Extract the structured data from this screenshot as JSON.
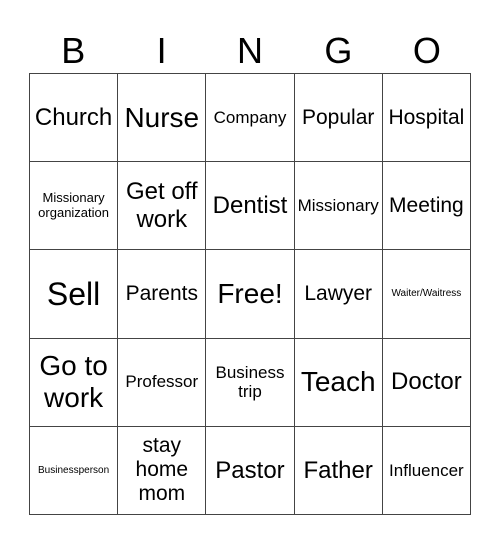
{
  "title_letters": [
    "B",
    "I",
    "N",
    "G",
    "O"
  ],
  "cells": [
    [
      {
        "text": "Church",
        "size": "s-ml"
      },
      {
        "text": "Nurse",
        "size": "s-l"
      },
      {
        "text": "Company",
        "size": "s-s"
      },
      {
        "text": "Popular",
        "size": "s-m"
      },
      {
        "text": "Hospital",
        "size": "s-m"
      }
    ],
    [
      {
        "text": "Missionary organization",
        "size": "s-xs"
      },
      {
        "text": "Get off work",
        "size": "s-ml"
      },
      {
        "text": "Dentist",
        "size": "s-ml"
      },
      {
        "text": "Missionary",
        "size": "s-s"
      },
      {
        "text": "Meeting",
        "size": "s-m"
      }
    ],
    [
      {
        "text": "Sell",
        "size": "s-xl"
      },
      {
        "text": "Parents",
        "size": "s-m"
      },
      {
        "text": "Free!",
        "size": "s-l"
      },
      {
        "text": "Lawyer",
        "size": "s-m"
      },
      {
        "text": "Waiter/Waitress",
        "size": "s-tiny"
      }
    ],
    [
      {
        "text": "Go to work",
        "size": "s-l"
      },
      {
        "text": "Professor",
        "size": "s-s"
      },
      {
        "text": "Business trip",
        "size": "s-s"
      },
      {
        "text": "Teach",
        "size": "s-l"
      },
      {
        "text": "Doctor",
        "size": "s-ml"
      }
    ],
    [
      {
        "text": "Businessperson",
        "size": "s-tiny"
      },
      {
        "text": "stay home mom",
        "size": "s-m"
      },
      {
        "text": "Pastor",
        "size": "s-ml"
      },
      {
        "text": "Father",
        "size": "s-ml"
      },
      {
        "text": "Influencer",
        "size": "s-s"
      }
    ]
  ]
}
